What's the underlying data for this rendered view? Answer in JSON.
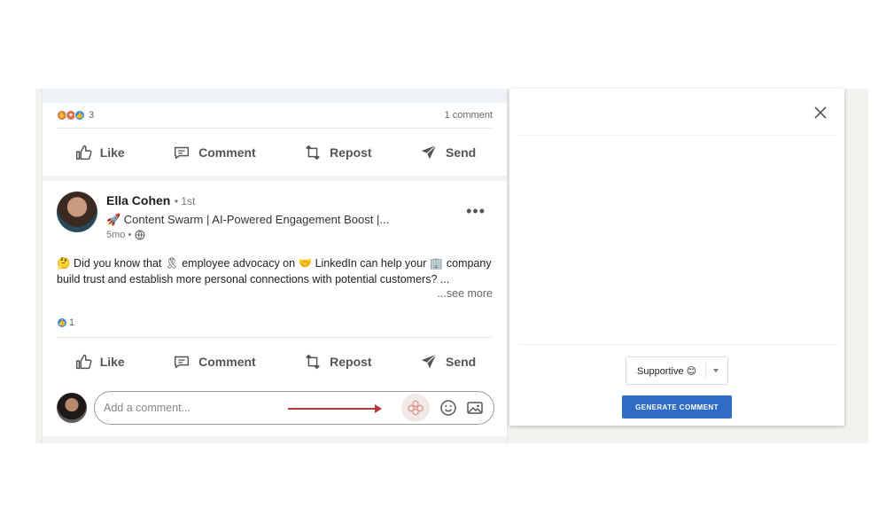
{
  "prev_post": {
    "reaction_count": "3",
    "comment_count": "1 comment"
  },
  "actions": {
    "like": "Like",
    "comment": "Comment",
    "repost": "Repost",
    "send": "Send"
  },
  "post": {
    "author_name": "Ella Cohen",
    "degree": "• 1st",
    "headline": "🚀 Content Swarm | AI-Powered Engagement Boost |...",
    "time": "5mo •",
    "more_menu": "•••",
    "text": "🤔 Did you know that 🎗 employee advocacy on 🤝 LinkedIn can help your 🏢 company build trust and establish more personal connections with potential customers? ...",
    "see_more": "...see more",
    "reaction_count": "1"
  },
  "comment_box": {
    "placeholder": "Add a comment..."
  },
  "panel": {
    "tone_selected": "Supportive 😊",
    "generate_label": "GENERATE COMMENT"
  },
  "colors": {
    "accent": "#2e6bc6",
    "arrow": "#b23a3a",
    "like_blue": "#378fe9"
  }
}
